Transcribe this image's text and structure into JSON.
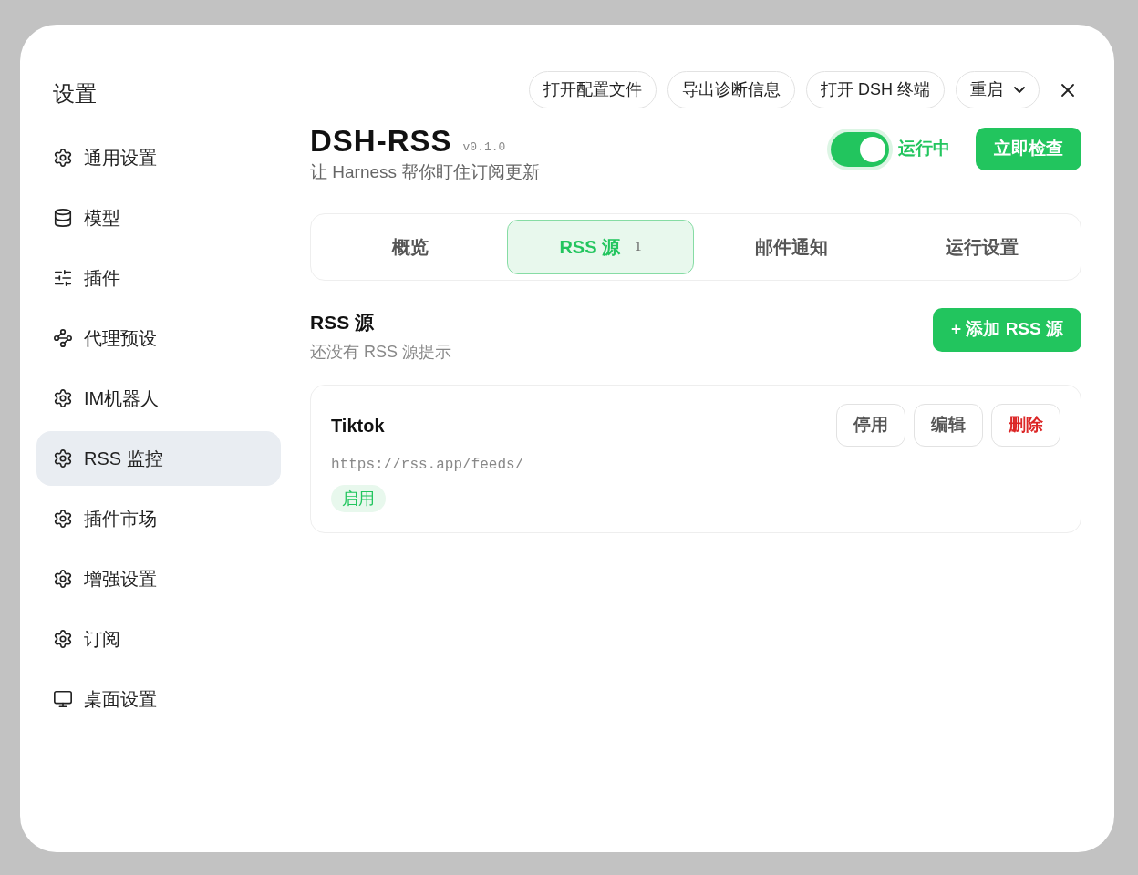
{
  "sidebar": {
    "title": "设置",
    "items": [
      {
        "label": "通用设置",
        "kind": "gear",
        "selected": false
      },
      {
        "label": "模型",
        "kind": "database",
        "selected": false
      },
      {
        "label": "插件",
        "kind": "sliders",
        "selected": false
      },
      {
        "label": "代理预设",
        "kind": "agent",
        "selected": false
      },
      {
        "label": "IM机器人",
        "kind": "gear",
        "selected": false
      },
      {
        "label": "RSS 监控",
        "kind": "gear",
        "selected": true
      },
      {
        "label": "插件市场",
        "kind": "gear",
        "selected": false
      },
      {
        "label": "增强设置",
        "kind": "gear",
        "selected": false
      },
      {
        "label": "订阅",
        "kind": "gear",
        "selected": false
      },
      {
        "label": "桌面设置",
        "kind": "monitor",
        "selected": false
      }
    ]
  },
  "toolbar": {
    "buttons": [
      {
        "label": "打开配置文件",
        "kind": "plain"
      },
      {
        "label": "导出诊断信息",
        "kind": "plain"
      },
      {
        "label": "打开 DSH 终端",
        "kind": "plain"
      },
      {
        "label": "重启",
        "kind": "dropdown"
      }
    ]
  },
  "header": {
    "title": "DSH-RSS",
    "version": "v0.1.0",
    "subtitle": "让 Harness 帮你盯住订阅更新",
    "running": {
      "on": true,
      "label": "运行中"
    },
    "action": "立即检查"
  },
  "tabs": [
    {
      "label": "概览",
      "selected": false
    },
    {
      "label": "RSS 源",
      "badge": "1",
      "selected": true
    },
    {
      "label": "邮件通知",
      "selected": false
    },
    {
      "label": "运行设置",
      "selected": false
    }
  ],
  "section": {
    "title": "RSS 源",
    "hint": "还没有 RSS 源提示",
    "add_button": "+ 添加 RSS 源"
  },
  "feeds": [
    {
      "name": "Tiktok",
      "url": "https://rss.app/feeds/",
      "status": "启用",
      "enabled": true,
      "actions": [
        {
          "label": "停用",
          "kind": "plain"
        },
        {
          "label": "编辑",
          "kind": "plain"
        },
        {
          "label": "删除",
          "kind": "danger"
        }
      ]
    }
  ]
}
